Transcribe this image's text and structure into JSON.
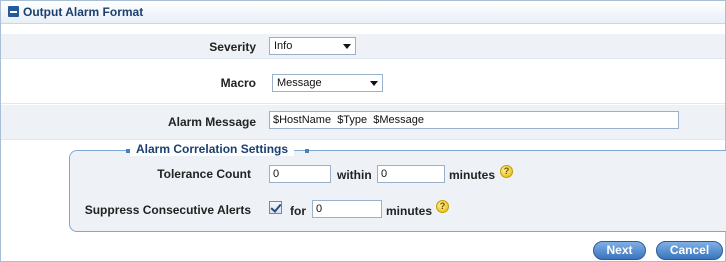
{
  "panel": {
    "title": "Output Alarm Format"
  },
  "form": {
    "severity": {
      "label": "Severity",
      "value": "Info"
    },
    "macro": {
      "label": "Macro",
      "value": "Message"
    },
    "alarm_message": {
      "label": "Alarm Message",
      "value": "$HostName  $Type  $Message"
    }
  },
  "correlation": {
    "legend": "Alarm Correlation Settings",
    "tolerance": {
      "label": "Tolerance Count",
      "count_value": "0",
      "within_label": "within",
      "within_value": "0",
      "minutes_label": "minutes"
    },
    "suppress": {
      "label": "Suppress Consecutive Alerts",
      "checked": true,
      "for_label": "for",
      "for_value": "0",
      "minutes_label": "minutes"
    },
    "help_glyph": "?"
  },
  "buttons": {
    "next": "Next",
    "cancel": "Cancel"
  },
  "icons": {
    "collapse": "collapse-minus-icon",
    "help": "help-question-icon",
    "dropdown": "chevron-down-icon"
  },
  "colors": {
    "title": "#1b3f6e",
    "button": "#3a74bd",
    "band": "#eef2f7",
    "help": "#e2b400"
  }
}
